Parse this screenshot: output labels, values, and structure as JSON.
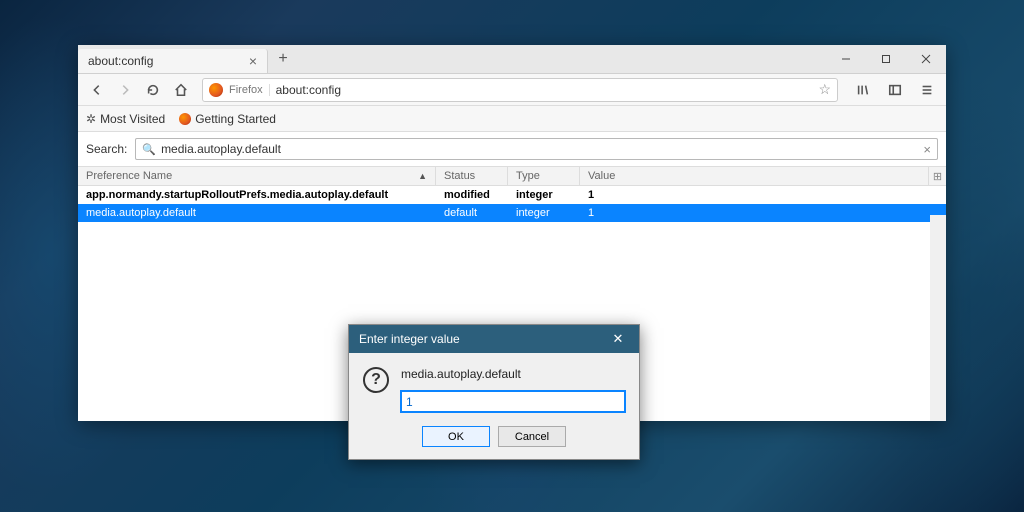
{
  "tab": {
    "title": "about:config"
  },
  "urlbar": {
    "brand": "Firefox",
    "url": "about:config"
  },
  "bookmarks": {
    "most_visited": "Most Visited",
    "getting_started": "Getting Started"
  },
  "search": {
    "label": "Search:",
    "value": "media.autoplay.default"
  },
  "columns": {
    "name": "Preference Name",
    "status": "Status",
    "type": "Type",
    "value": "Value"
  },
  "rows": [
    {
      "name": "app.normandy.startupRolloutPrefs.media.autoplay.default",
      "status": "modified",
      "type": "integer",
      "value": "1",
      "bold": true,
      "selected": false
    },
    {
      "name": "media.autoplay.default",
      "status": "default",
      "type": "integer",
      "value": "1",
      "bold": false,
      "selected": true
    }
  ],
  "dialog": {
    "title": "Enter integer value",
    "pref_name": "media.autoplay.default",
    "input_value": "1",
    "ok": "OK",
    "cancel": "Cancel"
  }
}
